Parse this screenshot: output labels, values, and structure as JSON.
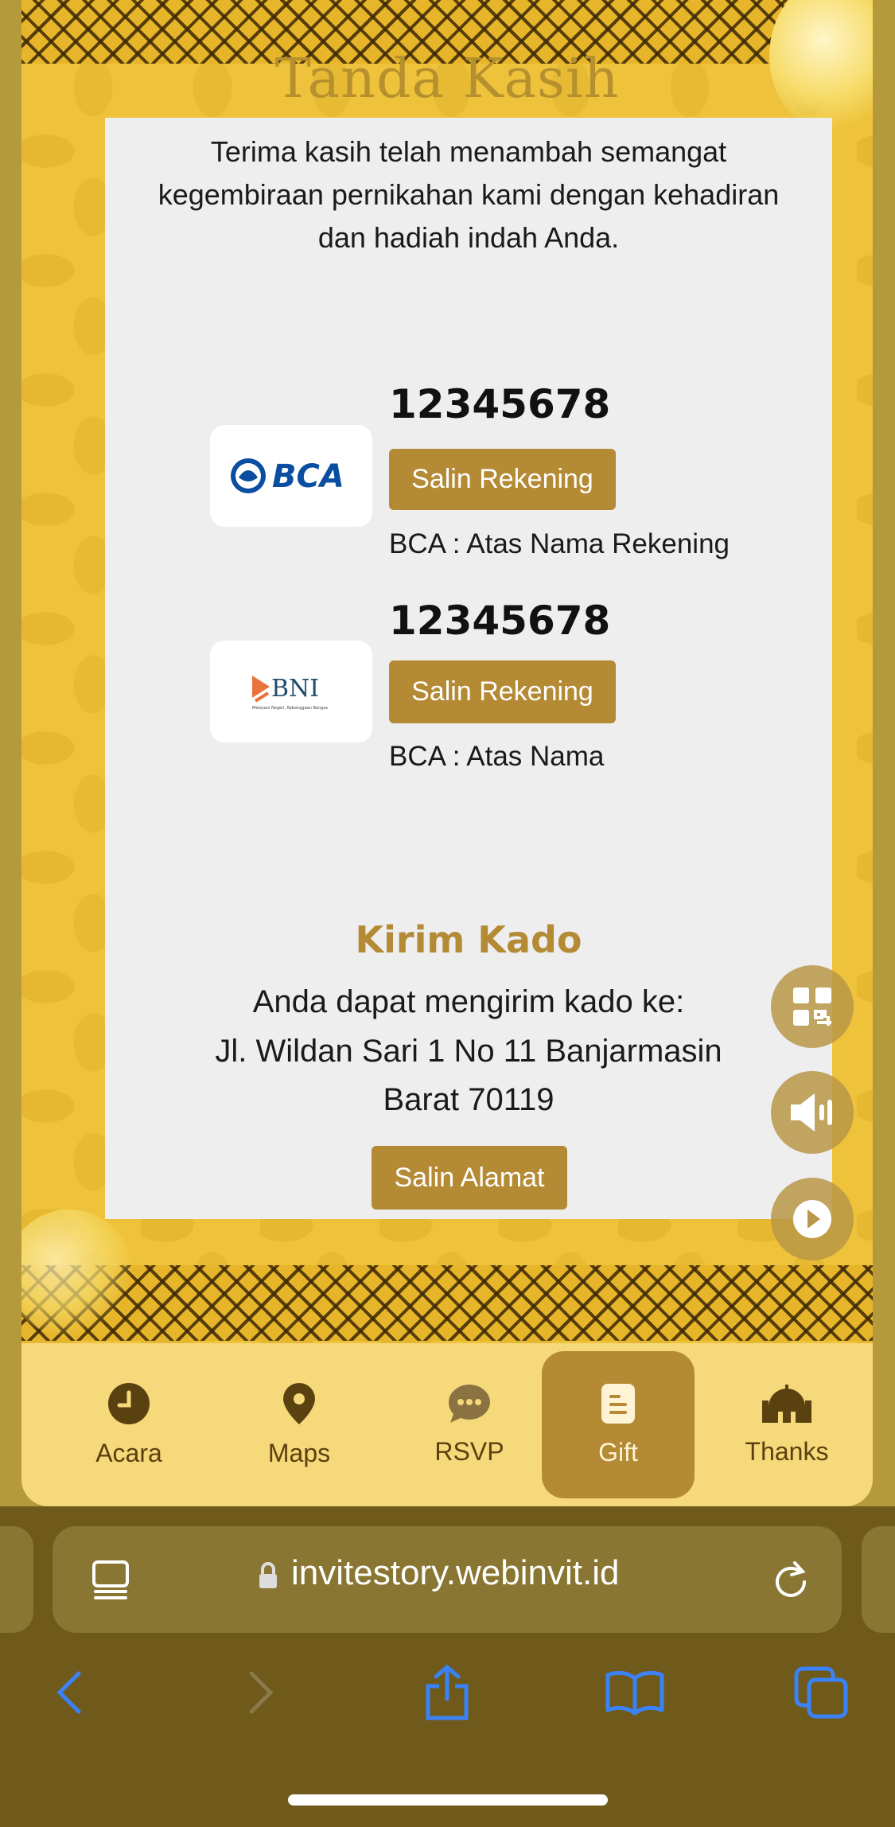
{
  "header": {
    "title": "Tanda Kasih"
  },
  "intro_text": "Terima kasih telah menambah semangat kegembiraan pernikahan kami dengan kehadiran dan hadiah indah Anda.",
  "banks": [
    {
      "logo": "BCA",
      "number": "12345678",
      "button_label": "Salin Rekening",
      "owner": "BCA : Atas Nama Rekening"
    },
    {
      "logo": "BNI",
      "logo_tagline": "Melayani Negeri, Kebanggaan Bangsa",
      "number": "12345678",
      "button_label": "Salin Rekening",
      "owner": "BCA : Atas Nama"
    }
  ],
  "kado": {
    "title": "Kirim Kado",
    "description": "Anda dapat mengirim kado ke:",
    "address": "Jl. Wildan Sari 1 No 11 Banjarmasin Barat 70119",
    "button_label": "Salin Alamat"
  },
  "floating_buttons": [
    "qr-code-icon",
    "speaker-icon",
    "play-icon"
  ],
  "bottom_nav": [
    {
      "label": "Acara",
      "icon": "clock-icon",
      "active": false
    },
    {
      "label": "Maps",
      "icon": "map-pin-icon",
      "active": false
    },
    {
      "label": "RSVP",
      "icon": "chat-icon",
      "active": false
    },
    {
      "label": "Gift",
      "icon": "document-icon",
      "active": true
    },
    {
      "label": "Thanks",
      "icon": "mosque-icon",
      "active": false
    }
  ],
  "browser": {
    "url": "invitestory.webinvit.id"
  },
  "colors": {
    "accent": "#b48a34",
    "frame": "#eec23a",
    "card": "#eeeeef",
    "nav": "#f6d97a",
    "browser": "#6f5a1c"
  }
}
